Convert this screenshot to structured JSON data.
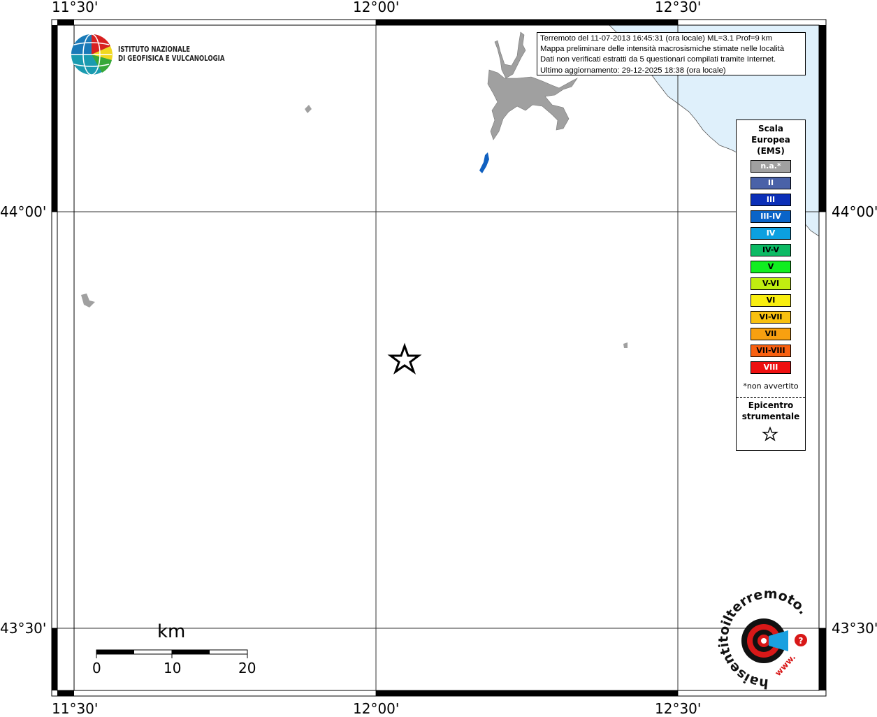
{
  "map": {
    "lon_labels": [
      "11°30'",
      "12°00'",
      "12°30'"
    ],
    "lat_labels": [
      "44°00'",
      "43°30'"
    ],
    "land_color": "#ffffff",
    "sea_color": "#dff0fb",
    "lake_color": "#a0a0a0",
    "epicenter_symbol": "star"
  },
  "info": {
    "line1": "Terremoto del 11-07-2013 16:45:31 (ora locale) ML=3.1 Prof=9 km",
    "line2": "Mappa preliminare delle intensità macrosismiche stimate nelle località",
    "line3": "Dati non verificati estratti da 5 questionari compilati tramite Internet.",
    "line4": "Ultimo aggiornamento: 29-12-2025 18:38 (ora locale)"
  },
  "legend": {
    "title": "Scala\nEuropea\n(EMS)",
    "title_l1": "Scala",
    "title_l2": "Europea",
    "title_l3": "(EMS)",
    "classes": [
      {
        "label": "n.a.*",
        "color": "#a0a0a0"
      },
      {
        "label": "II",
        "color": "#4a62a8"
      },
      {
        "label": "III",
        "color": "#0b2fb8"
      },
      {
        "label": "III-IV",
        "color": "#0a64c8"
      },
      {
        "label": "IV",
        "color": "#0ca0e0"
      },
      {
        "label": "IV-V",
        "color": "#0cba64"
      },
      {
        "label": "V",
        "color": "#10ee20"
      },
      {
        "label": "V-VI",
        "color": "#c0ee10"
      },
      {
        "label": "VI",
        "color": "#f8ee10"
      },
      {
        "label": "VI-VII",
        "color": "#f8c010"
      },
      {
        "label": "VII",
        "color": "#f8a010"
      },
      {
        "label": "VII-VIII",
        "color": "#f86010"
      },
      {
        "label": "VIII",
        "color": "#ee1010"
      }
    ],
    "note": "*non avvertito",
    "epicenter_l1": "Epicentro",
    "epicenter_l2": "strumentale"
  },
  "logo": {
    "ingv_line1": "ISTITUTO NAZIONALE",
    "ingv_line2": "DI GEOFISICA E VULCANOLOGIA",
    "hsit_text": "haisentitoilterremoto.it",
    "hsit_prefix": "www."
  },
  "scalebar": {
    "unit": "km",
    "ticks": [
      "0",
      "10",
      "20"
    ]
  }
}
